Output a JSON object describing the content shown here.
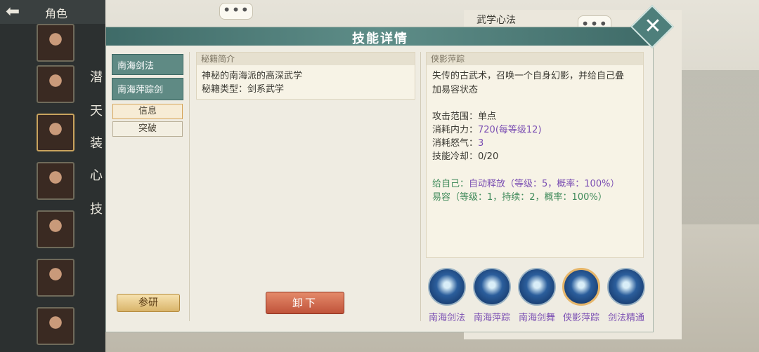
{
  "header": {
    "back_icon": "left-arrow-icon",
    "role_label": "角色"
  },
  "side_menu": [
    "潜",
    "天",
    "装",
    "心",
    "技"
  ],
  "right_panel": {
    "heading": "武学心法"
  },
  "modal": {
    "title": "技能详情",
    "tabs": [
      "南海剑法",
      "南海萍踪剑"
    ],
    "subtabs": [
      "信息",
      "突破"
    ],
    "intro": {
      "heading": "秘籍简介",
      "line1": "神秘的南海派的高深武学",
      "line2": "秘籍类型：剑系武学"
    },
    "detail": {
      "heading": "侠影萍踪",
      "desc1": "失传的古武术，召唤一个自身幻影，并给自己叠",
      "desc2": "加易容状态",
      "range_label": "攻击范围：",
      "range_value": "单点",
      "mp_label": "消耗内力：",
      "mp_value": "720(每等级12)",
      "rage_label": "消耗怒气：",
      "rage_value": "3",
      "cd_label": "技能冷却：",
      "cd_value": "0/20",
      "self_label": "给自己：",
      "self_value": "自动释放（等级：5，概率：100%）",
      "disguise": "易容（等级：1，持续：2，概率：100%）"
    },
    "buttons": {
      "research": "参研",
      "unequip": "卸下"
    },
    "skills": [
      "南海剑法",
      "南海萍踪",
      "南海剑舞",
      "侠影萍踪",
      "剑法精通"
    ],
    "selected_skill_index": 3
  },
  "colors": {
    "header": "#4e7f7b",
    "accent_purple": "#7b4fb3",
    "accent_green": "#3f8a5a"
  }
}
